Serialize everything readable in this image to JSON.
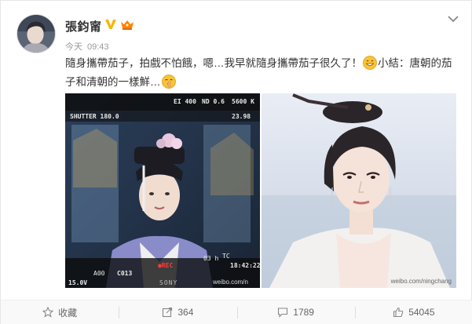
{
  "post": {
    "author": "張鈞甯",
    "time_label": "今天",
    "time": "09:43",
    "text_part1": "隨身攜帶茄子，拍戲不怕餓，嗯…我早就隨身攜帶茄子很久了！",
    "text_part2": "小結：唐朝的茄子和清朝的一樣鮮…",
    "images": [
      {
        "overlay": {
          "shutter": "SHUTTER 180.0",
          "iso": "EI 400",
          "nd": "ND 0.6",
          "wb": "5600 K",
          "fps": "23.98",
          "timecode": "18:42:22",
          "tc_label": "TC",
          "rec": "REC",
          "clip": "C013",
          "acode": "A00",
          "battery": "15.0V",
          "elapsed": "03 h",
          "brand": "SONY",
          "watermark": "weibo.com/n"
        }
      },
      {
        "overlay": {
          "watermark": "weibo.com/ningchang"
        }
      }
    ]
  },
  "actions": {
    "favorite": "收藏",
    "repost": "364",
    "comment": "1789",
    "like": "54045"
  },
  "colors": {
    "accent_orange": "#ff8200",
    "verified_gold": "#f6b700",
    "muted": "#999999"
  }
}
